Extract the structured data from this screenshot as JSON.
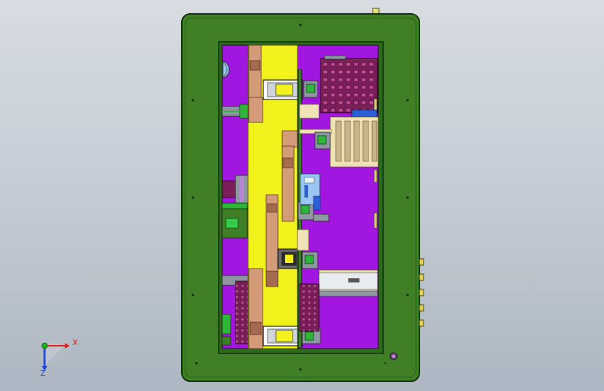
{
  "viewport": {
    "background_top": "#d9dde2",
    "background_bottom": "#aeb7c1"
  },
  "colors": {
    "frame_green": "#3f7f26",
    "frame_outline": "#0f2a08",
    "cavity_magenta": "#a117e0",
    "slide_yellow": "#f2f21d",
    "block_copper": "#d49b79",
    "block_copper_dark": "#a66b4f",
    "grid_maroon": "#7a1e57",
    "cream": "#f0e3b8",
    "light_blue": "#9bc6f3",
    "small_green": "#2fb53a",
    "gray": "#8e98a2",
    "axis_x": "#e01b1b",
    "axis_y": "#18b41b",
    "axis_z": "#2447d6"
  },
  "triad": {
    "x_label": "X",
    "z_label": "Z"
  },
  "icons": [
    "coordinate-triad-icon"
  ]
}
